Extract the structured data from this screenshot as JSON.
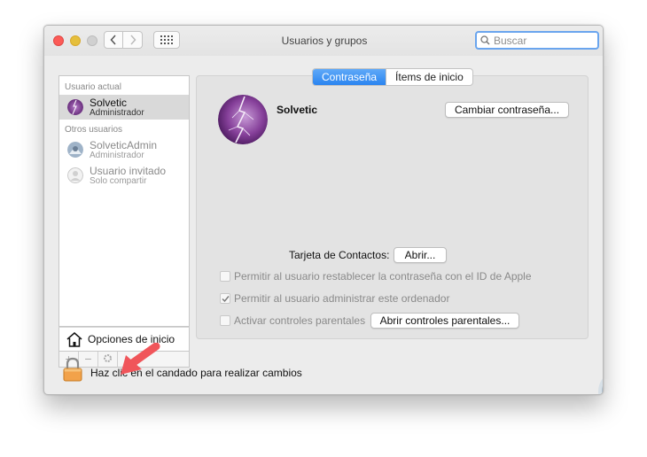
{
  "window": {
    "title": "Usuarios y grupos",
    "search_placeholder": "Buscar"
  },
  "sidebar": {
    "current_header": "Usuario actual",
    "current_user": {
      "name": "Solvetic",
      "role": "Administrador"
    },
    "others_header": "Otros usuarios",
    "other_users": [
      {
        "name": "SolveticAdmin",
        "role": "Administrador"
      },
      {
        "name": "Usuario invitado",
        "role": "Solo compartir"
      }
    ],
    "login_options_label": "Opciones de inicio",
    "add_symbol": "+",
    "remove_symbol": "−"
  },
  "tabs": [
    {
      "label": "Contraseña",
      "active": true
    },
    {
      "label": "Ítems de inicio",
      "active": false
    }
  ],
  "profile": {
    "name": "Solvetic",
    "change_password_label": "Cambiar contraseña..."
  },
  "contacts": {
    "label": "Tarjeta de Contactos:",
    "open_label": "Abrir..."
  },
  "options": [
    {
      "label": "Permitir al usuario restablecer la contraseña con el ID de Apple",
      "checked": false
    },
    {
      "label": "Permitir al usuario administrar este ordenador",
      "checked": true
    },
    {
      "label": "Activar controles parentales",
      "checked": false
    }
  ],
  "parental_button_label": "Abrir controles parentales...",
  "lock_text": "Haz clic en el candado para realizar cambios",
  "colors": {
    "accent": "#2a84f0",
    "arrow": "#f0555a",
    "lock": "#f2a24a",
    "selected_row": "#d9d9d9"
  }
}
